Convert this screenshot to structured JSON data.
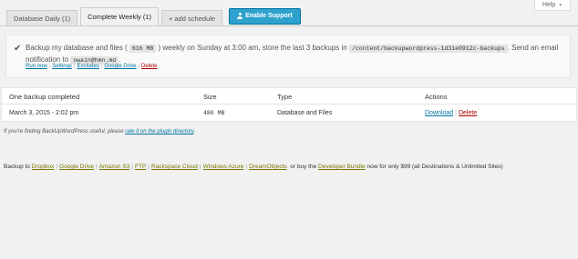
{
  "help": {
    "label": "Help"
  },
  "tabs": [
    {
      "label": "Database Daily (1)"
    },
    {
      "label": "Complete Weekly (1)"
    },
    {
      "label": "+ add schedule"
    }
  ],
  "support_button": {
    "label": "Enable Support"
  },
  "schedule": {
    "text_1": "Backup my database and files (",
    "size": "616 MB",
    "text_2": ") weekly on Sunday at 3:00 am, store the last 3 backups in",
    "path": "/content/backupwordpress-1d31e0912c-backups",
    "text_3": ". Send an email notification to",
    "email": "owain@hmn.md",
    "text_4": ".",
    "actions": [
      "Run now",
      "Settings",
      "Excludes",
      "Google Drive",
      "Delete"
    ]
  },
  "table": {
    "headers": [
      "One backup completed",
      "Size",
      "Type",
      "Actions"
    ],
    "rows": [
      {
        "date": "March 3, 2015 - 2:02 pm",
        "size": "480 MB",
        "type": "Database and Files",
        "download": "Download",
        "sep": "|",
        "delete": "Delete"
      }
    ]
  },
  "note": {
    "prefix": "If you're finding BackUpWordPress useful, please",
    "link": "rate it on the plugin directory",
    "suffix": "."
  },
  "footer": {
    "prefix": "Backup to",
    "destinations": [
      "Dropbox",
      "Google Drive",
      "Amazon S3",
      "FTP",
      "Rackspace Cloud",
      "Windows Azure",
      "DreamObjects"
    ],
    "middle": "or buy the",
    "bundle_link": "Developer Bundle",
    "suffix": "now for only $99 (all Destinations & Unlimited Sites)"
  },
  "colors": {
    "link": "#0074a2",
    "delete": "#aa0000",
    "button": "#2ea2cc",
    "footer_link": "#777700"
  }
}
